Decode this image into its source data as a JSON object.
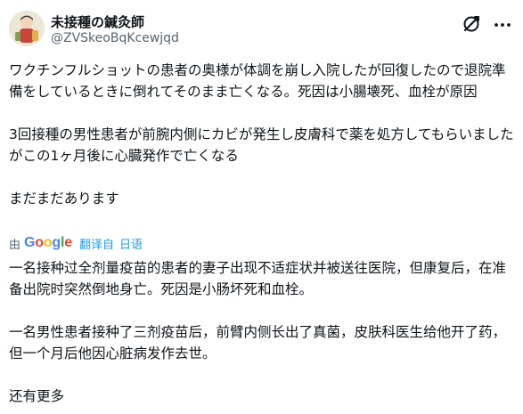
{
  "author": {
    "name": "未接種の鍼灸師",
    "handle": "@ZVSkeoBqKcewjqd"
  },
  "icons": {
    "grok": "grok-icon",
    "more": "more-icon"
  },
  "post": {
    "paragraph_1": "ワクチンフルショットの患者の奥様が体調を崩し入院したが回復したので退院準備をしているときに倒れてそのまま亡くなる。死因は小腸壊死、血栓が原因",
    "paragraph_2": "3回接種の男性患者が前腕内側にカビが発生し皮膚科で薬を処方してもらいましたがこの1ヶ月後に心臓発作で亡くなる",
    "paragraph_3": "まだまだあります"
  },
  "translation": {
    "by_label": "由",
    "provider": "Google",
    "translate_link": "翻译自",
    "source_language": "日语",
    "paragraph_1": "一名接种过全剂量疫苗的患者的妻子出现不适症状并被送往医院，但康复后，在准备出院时突然倒地身亡。死因是小肠坏死和血栓。",
    "paragraph_2": "一名男性患者接种了三剂疫苗后，前臂内侧长出了真菌，皮肤科医生给他开了药，但一个月后他因心脏病发作去世。",
    "paragraph_3": "还有更多"
  },
  "colors": {
    "text": "#0f1419",
    "secondary": "#536471",
    "link": "#1d9bf0",
    "google_blue": "#4285f4",
    "google_red": "#ea4335",
    "google_yellow": "#fbbc05",
    "google_green": "#34a853"
  }
}
